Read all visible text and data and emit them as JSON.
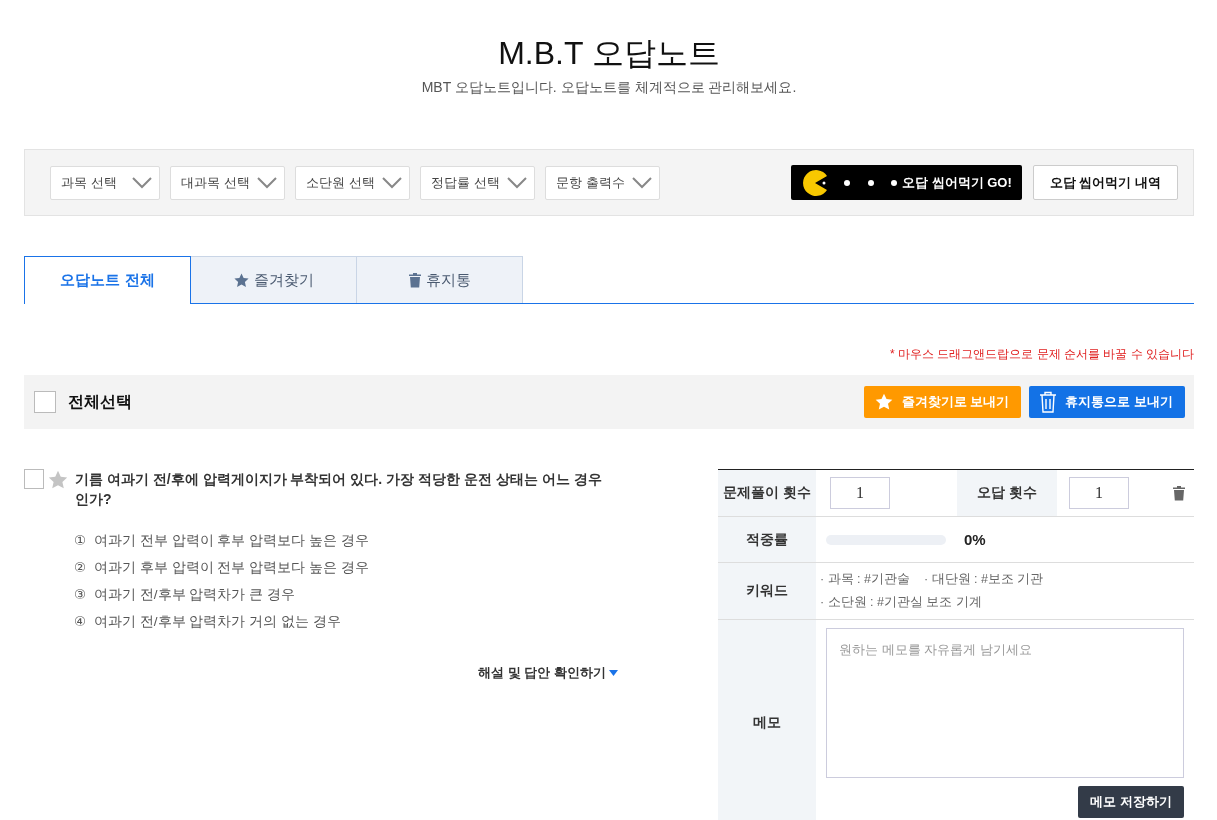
{
  "header": {
    "title": "M.B.T 오답노트",
    "subtitle": "MBT 오답노트입니다. 오답노트를 체계적으로 관리해보세요."
  },
  "filters": [
    {
      "label": "과목 선택"
    },
    {
      "label": "대과목 선택"
    },
    {
      "label": "소단원 선택"
    },
    {
      "label": "정답률 선택"
    },
    {
      "label": "문항 출력수"
    }
  ],
  "actions": {
    "go_button": "오답 씹어먹기 GO!",
    "history_button": "오답 씹어먹기 내역"
  },
  "tabs": [
    {
      "label": "오답노트 전체",
      "kind": "all",
      "selected": true
    },
    {
      "label": "즐겨찾기",
      "kind": "favorites",
      "selected": false
    },
    {
      "label": "휴지통",
      "kind": "trash",
      "selected": false
    }
  ],
  "notice": "* 마우스 드래그앤드랍으로 문제 순서를 바꿀 수 있습니다",
  "toolbar": {
    "select_all": {
      "label": "전체선택",
      "checked": false
    },
    "favorite_button": "즐겨찾기로 보내기",
    "trash_button": "휴지통으로 보내기"
  },
  "question": {
    "checked": false,
    "favorite": false,
    "text": "기름 여과기 전/후에 압력게이지가 부착되어 있다. 가장 적당한 운전 상태는 어느 경우인가?",
    "options": [
      {
        "number": "①",
        "text": "여과기 전부 압력이 후부 압력보다 높은 경우"
      },
      {
        "number": "②",
        "text": "여과기 후부 압력이 전부 압력보다 높은 경우"
      },
      {
        "number": "③",
        "text": "여과기 전/후부 압력차가 큰 경우"
      },
      {
        "number": "④",
        "text": "여과기 전/후부 압력차가 거의 없는 경우"
      }
    ],
    "explain_link": "해설 및 답안 확인하기"
  },
  "panel": {
    "solve_count": {
      "label": "문제풀이 횟수",
      "value": "1"
    },
    "wrong_count": {
      "label": "오답 횟수",
      "value": "1"
    },
    "accuracy": {
      "label": "적중률",
      "level": 0,
      "reading": "0%"
    },
    "keywords": {
      "label": "키워드",
      "items": [
        "· 과목 : #기관술",
        "· 대단원 : #보조 기관",
        "· 소단원 : #기관실 보조 기계"
      ]
    },
    "memo": {
      "label": "메모",
      "placeholder": "원하는 메모를 자유롭게 남기세요",
      "save_button": "메모 저장하기"
    }
  }
}
